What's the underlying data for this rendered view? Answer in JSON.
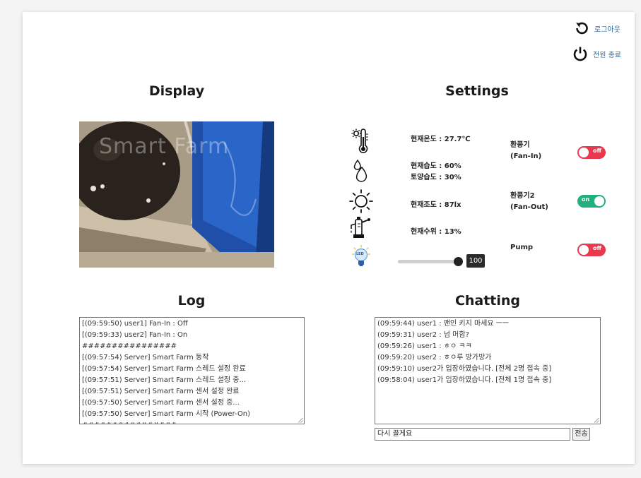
{
  "header": {
    "logout_label": "로그아웃",
    "shutdown_label": "전원 종료"
  },
  "display": {
    "title": "Display",
    "watermark": "Smart Farm"
  },
  "settings": {
    "title": "Settings",
    "readings": {
      "temperature": "현재온도 : 27.7℃",
      "humidity": "현재습도 : 60%",
      "soil_moisture": "토양습도 : 30%",
      "illuminance": "현재조도 : 87lx",
      "water_level": "현재수위 : 13%"
    },
    "controls": {
      "fan_in": {
        "label_line1": "환풍기",
        "label_line2": "(Fan-In)",
        "state": "off"
      },
      "fan_out": {
        "label_line1": "환풍기2",
        "label_line2": "(Fan-Out)",
        "state": "on"
      },
      "pump": {
        "label": "Pump",
        "state": "off"
      }
    },
    "led": {
      "icon_text": "LED",
      "value": "100",
      "level_fraction": 1.0
    }
  },
  "log": {
    "title": "Log",
    "lines": [
      "[(09:59:50) user1] Fan-In : Off",
      "[(09:59:33) user2] Fan-In : On",
      "################",
      "[(09:57:54) Server] Smart Farm 동작",
      "[(09:57:54) Server] Smart Farm 스레드 설정 완료",
      "[(09:57:51) Server] Smart Farm 스레드 설정 중...",
      "[(09:57:51) Server] Smart Farm 센서 설정 완료",
      "[(09:57:50) Server] Smart Farm 센서 설정 중...",
      "[(09:57:50) Server] Smart Farm 시작 (Power-On)",
      "################"
    ]
  },
  "chatting": {
    "title": "Chatting",
    "lines": [
      "(09:59:44) user1 : 팬인 키지 마세요 ㅡㅡ",
      "(09:59:31) user2 : 넘 머함?",
      "(09:59:26) user1 : ㅎㅇ ㅋㅋ",
      "(09:59:20) user2 : ㅎㅇ루 방가방가",
      "(09:59:10) user2가 입장하였습니다. [전체 2명 접속 중]",
      "(09:58:04) user1가 입장하였습니다. [전체 1명 접속 중]"
    ],
    "input_value": "다시 끌게요",
    "send_label": "전송"
  },
  "colors": {
    "toggle_off": "#e8394f",
    "toggle_on": "#23b07d",
    "link": "#2b6cb0"
  },
  "icons": [
    "refresh-icon",
    "power-icon",
    "thermometer-sun-icon",
    "water-drops-icon",
    "sun-icon",
    "water-pump-icon",
    "led-bulb-icon"
  ]
}
